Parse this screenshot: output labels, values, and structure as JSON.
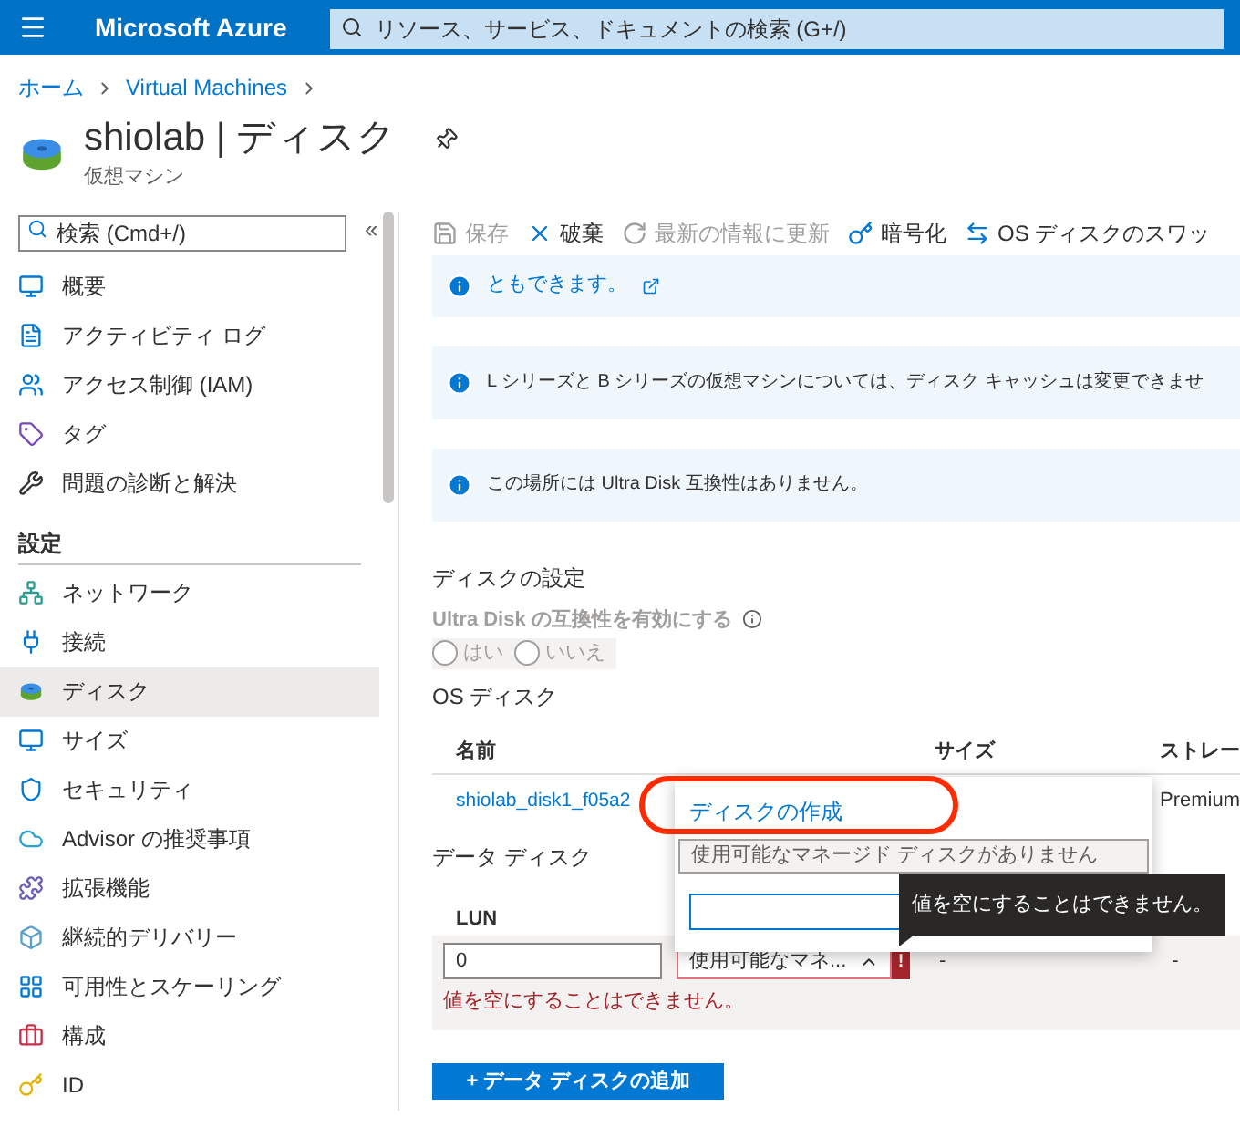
{
  "top_bar": {
    "brand": "Microsoft Azure",
    "search_placeholder": "リソース、サービス、ドキュメントの検索 (G+/)"
  },
  "breadcrumb": [
    "ホーム",
    "Virtual Machines"
  ],
  "page": {
    "title": "shiolab | ディスク",
    "subtitle": "仮想マシン"
  },
  "sidebar": {
    "search_placeholder": "検索 (Cmd+/)",
    "collapse": "«",
    "groups": [
      {
        "items": [
          {
            "label": "概要",
            "selected": false
          },
          {
            "label": "アクティビティ ログ",
            "selected": false
          },
          {
            "label": "アクセス制御 (IAM)",
            "selected": false
          },
          {
            "label": "タグ",
            "selected": false
          },
          {
            "label": "問題の診断と解決",
            "selected": false
          }
        ]
      },
      {
        "heading": "設定",
        "items": [
          {
            "label": "ネットワーク",
            "selected": false
          },
          {
            "label": "接続",
            "selected": false
          },
          {
            "label": "ディスク",
            "selected": true
          },
          {
            "label": "サイズ",
            "selected": false
          },
          {
            "label": "セキュリティ",
            "selected": false
          },
          {
            "label": "Advisor の推奨事項",
            "selected": false
          },
          {
            "label": "拡張機能",
            "selected": false
          },
          {
            "label": "継続的デリバリー",
            "selected": false
          },
          {
            "label": "可用性とスケーリング",
            "selected": false
          },
          {
            "label": "構成",
            "selected": false
          },
          {
            "label": "ID",
            "selected": false
          }
        ]
      }
    ]
  },
  "toolbar": [
    {
      "label": "保存",
      "disabled": true
    },
    {
      "label": "破棄",
      "disabled": false
    },
    {
      "label": "最新の情報に更新",
      "disabled": true
    },
    {
      "label": "暗号化",
      "disabled": false
    },
    {
      "label": "OS ディスクのスワッ",
      "disabled": false
    }
  ],
  "banners": [
    {
      "kind": "link",
      "text": "ともできます。"
    },
    {
      "kind": "info",
      "text": "L シリーズと B シリーズの仮想マシンについては、ディスク キャッシュは変更できませ"
    },
    {
      "kind": "info",
      "text": "この場所には Ultra Disk 互換性はありません。"
    }
  ],
  "disk_settings": {
    "title": "ディスクの設定",
    "ultra_disk_label": "Ultra Disk の互換性を有効にする",
    "disabled": true,
    "options": [
      {
        "label": "はい",
        "selected": false
      },
      {
        "label": "いいえ",
        "selected": false
      }
    ]
  },
  "os_disk": {
    "title": "OS ディスク",
    "columns": [
      "名前",
      "サイズ",
      "ストレー"
    ],
    "row": {
      "name": "shiolab_disk1_f05a2",
      "storage": "Premium"
    }
  },
  "data_disks": {
    "title": "データ ディスク",
    "columns": [
      "LUN"
    ],
    "row": {
      "lun": "0",
      "disk": "使用可能なマネ...",
      "invalid": true,
      "error_mark": "!",
      "error": "値を空にすることはできません。",
      "column_3": "-",
      "column_4": "-"
    }
  },
  "add_button": "+ データ ディスクの追加",
  "dropdown": {
    "create_link": "ディスクの作成",
    "option": {
      "label": "使用可能なマネージド ディスクがありません",
      "disabled": true
    }
  },
  "tooltip": "値を空にすることはできません。"
}
